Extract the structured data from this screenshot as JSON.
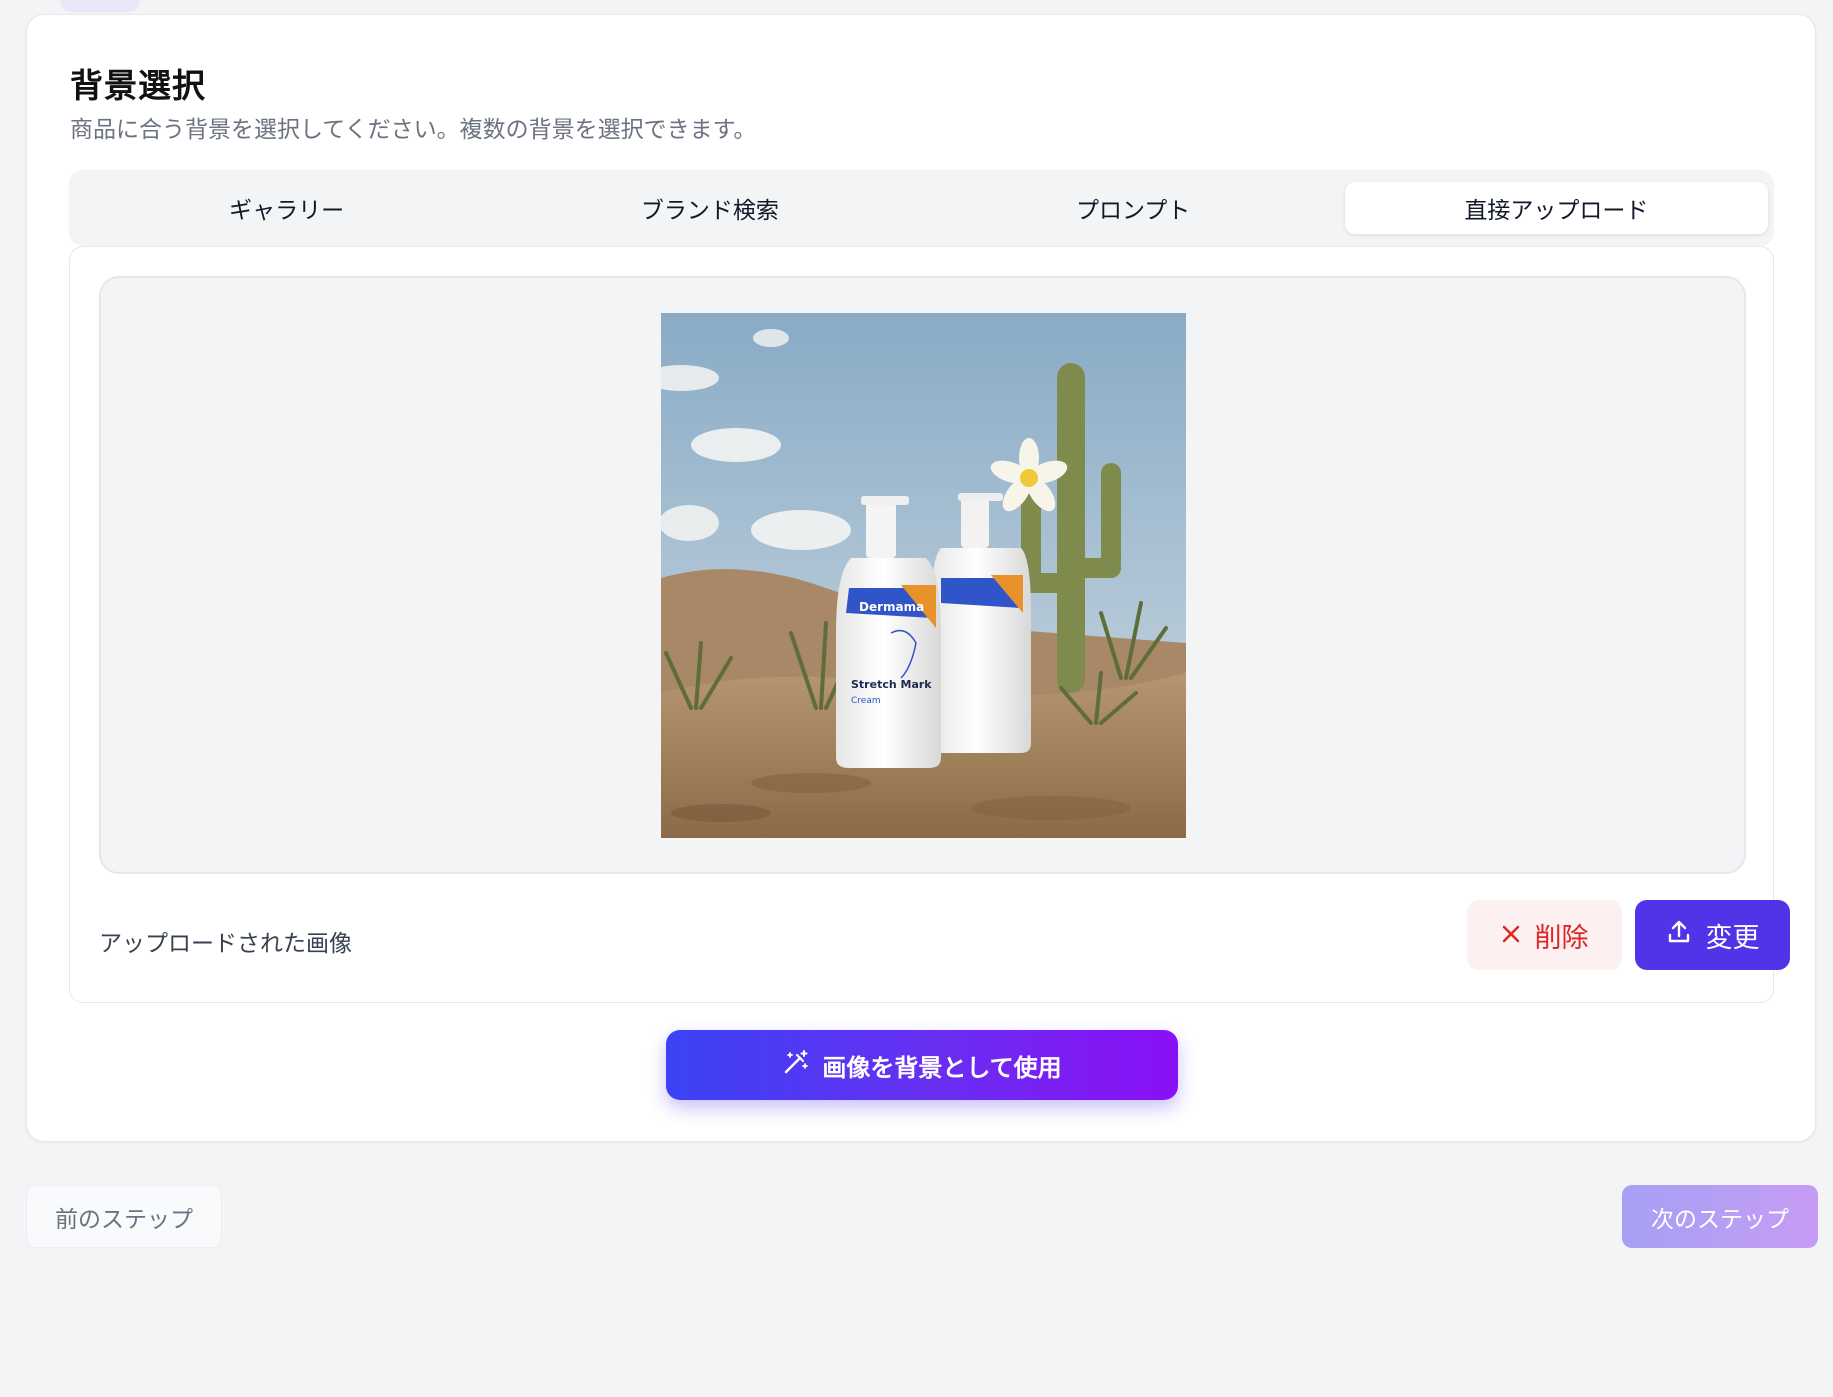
{
  "header": {
    "title": "背景選択",
    "subtitle": "商品に合う背景を選択してください。複数の背景を選択できます。"
  },
  "tabs": [
    {
      "label": "ギャラリー",
      "active": false
    },
    {
      "label": "ブランド検索",
      "active": false
    },
    {
      "label": "プロンプト",
      "active": false
    },
    {
      "label": "直接アップロード",
      "active": true
    }
  ],
  "upload": {
    "caption": "アップロードされた画像",
    "delete_label": "削除",
    "change_label": "変更",
    "delete_icon": "close-icon",
    "change_icon": "upload-icon",
    "image": {
      "bottle_brand": "Dermama",
      "bottle_product": "Stretch Mark",
      "bottle_sub": "Cream"
    }
  },
  "actions": {
    "use_as_background_label": "画像を背景として使用",
    "use_icon": "magic-wand-icon"
  },
  "navigation": {
    "prev_label": "前のステップ",
    "next_label": "次のステップ"
  },
  "colors": {
    "primary": "#4f34e8",
    "danger": "#dc2626",
    "gradient_start": "#3b43f5",
    "gradient_end": "#8b0ff5"
  }
}
